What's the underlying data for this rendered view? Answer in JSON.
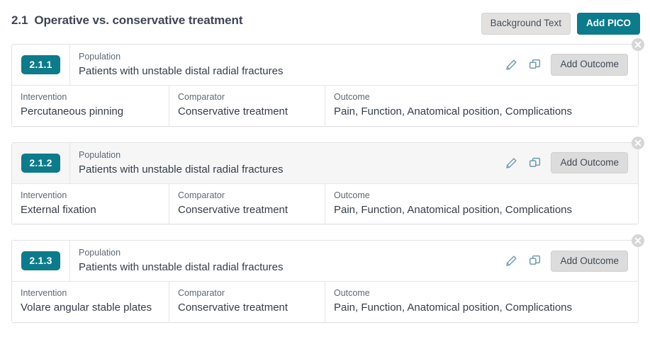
{
  "header": {
    "section_number": "2.1",
    "section_title": "Operative vs. conservative treatment",
    "background_text_label": "Background Text",
    "add_pico_label": "Add PICO"
  },
  "labels": {
    "population": "Population",
    "intervention": "Intervention",
    "comparator": "Comparator",
    "outcome": "Outcome",
    "add_outcome": "Add Outcome",
    "edit_icon": "pencil-icon",
    "duplicate_icon": "duplicate-icon",
    "close_icon": "close-icon"
  },
  "colors": {
    "accent_teal": "#0c7b8b",
    "icon_teal": "#6d9fa9",
    "button_grey": "#e2e1df",
    "add_outcome_grey": "#dcdcdc",
    "close_grey": "#d6d6d6",
    "shaded_row": "#f6f6f6",
    "border": "#e2e2e2",
    "text": "#3c4450"
  },
  "picos": [
    {
      "badge": "2.1.1",
      "population": "Patients with unstable distal radial fractures",
      "intervention": "Percutaneous pinning",
      "comparator": "Conservative treatment",
      "outcome": "Pain, Function, Anatomical position, Complications",
      "shaded": false
    },
    {
      "badge": "2.1.2",
      "population": "Patients with unstable distal radial fractures",
      "intervention": "External fixation",
      "comparator": "Conservative treatment",
      "outcome": "Pain, Function, Anatomical position, Complications",
      "shaded": true
    },
    {
      "badge": "2.1.3",
      "population": "Patients with unstable distal radial fractures",
      "intervention": "Volare angular stable plates",
      "comparator": "Conservative treatment",
      "outcome": "Pain, Function, Anatomical position, Complications",
      "shaded": false
    }
  ]
}
